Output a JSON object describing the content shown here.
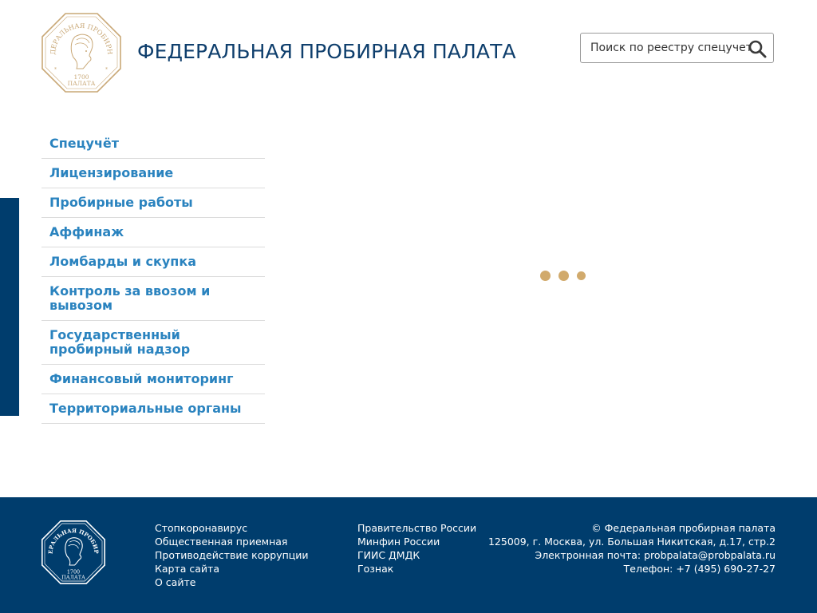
{
  "header": {
    "logo": {
      "arc_text": "ФЕДЕРАЛЬНАЯ ПРОБИРНАЯ",
      "year": "1700",
      "bottom_text": "ПАЛАТА"
    },
    "title": "ФЕДЕРАЛЬНАЯ ПРОБИРНАЯ ПАЛАТА",
    "search": {
      "placeholder": "Поиск по реестру спецучета"
    }
  },
  "nav": {
    "items": [
      {
        "label": "Спецучёт"
      },
      {
        "label": "Лицензирование"
      },
      {
        "label": "Пробирные работы"
      },
      {
        "label": "Аффинаж"
      },
      {
        "label": "Ломбарды и скупка"
      },
      {
        "label": "Контроль за ввозом и вывозом"
      },
      {
        "label": "Государственный пробирный надзор"
      },
      {
        "label": "Финансовый мониторинг"
      },
      {
        "label": "Территориальные органы"
      }
    ]
  },
  "footer": {
    "col1": [
      "Стопкоронавирус",
      "Общественная приемная",
      "Противодействие коррупции",
      "Карта сайта",
      "О сайте"
    ],
    "col2": [
      "Правительство России",
      "Минфин России",
      "ГИИС ДМДК",
      "Гознак"
    ],
    "contacts": {
      "copyright": "© Федеральная пробирная палата",
      "address": "125009, г. Москва, ул. Большая Никитская, д.17, стр.2",
      "email": "Электронная почта: probpalata@probpalata.ru",
      "phone": "Телефон: +7 (495) 690-27-27"
    }
  },
  "colors": {
    "brand": "#003d6d",
    "link": "#2a83bf",
    "gold": "#d1aa6c"
  }
}
